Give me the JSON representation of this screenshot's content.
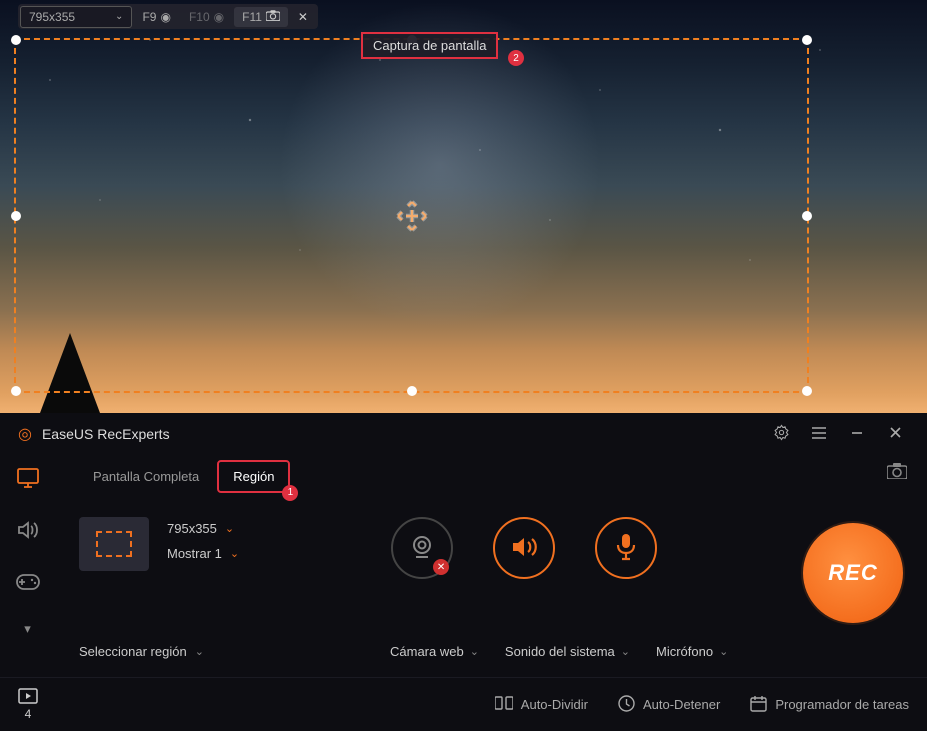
{
  "toolbar": {
    "dimensions": "795x355",
    "hotkeys": {
      "record": "F9",
      "pause": "F10",
      "screenshot": "F11"
    },
    "tooltip": "Captura de pantalla",
    "tooltip_badge": "2"
  },
  "app": {
    "title": "EaseUS RecExperts",
    "tabs": {
      "full": "Pantalla Completa",
      "region": "Región",
      "region_badge": "1"
    },
    "region_config": {
      "dimensions": "795x355",
      "display": "Mostrar 1"
    },
    "select_region": "Seleccionar región",
    "devices": {
      "webcam": "Cámara web",
      "system_sound": "Sonido del sistema",
      "microphone": "Micrófono"
    },
    "record_label": "REC",
    "recordings_count": "4",
    "bottom": {
      "auto_split": "Auto-Dividir",
      "auto_stop": "Auto-Detener",
      "scheduler": "Programador de tareas"
    }
  },
  "colors": {
    "accent": "#f07020",
    "highlight": "#e03040"
  }
}
